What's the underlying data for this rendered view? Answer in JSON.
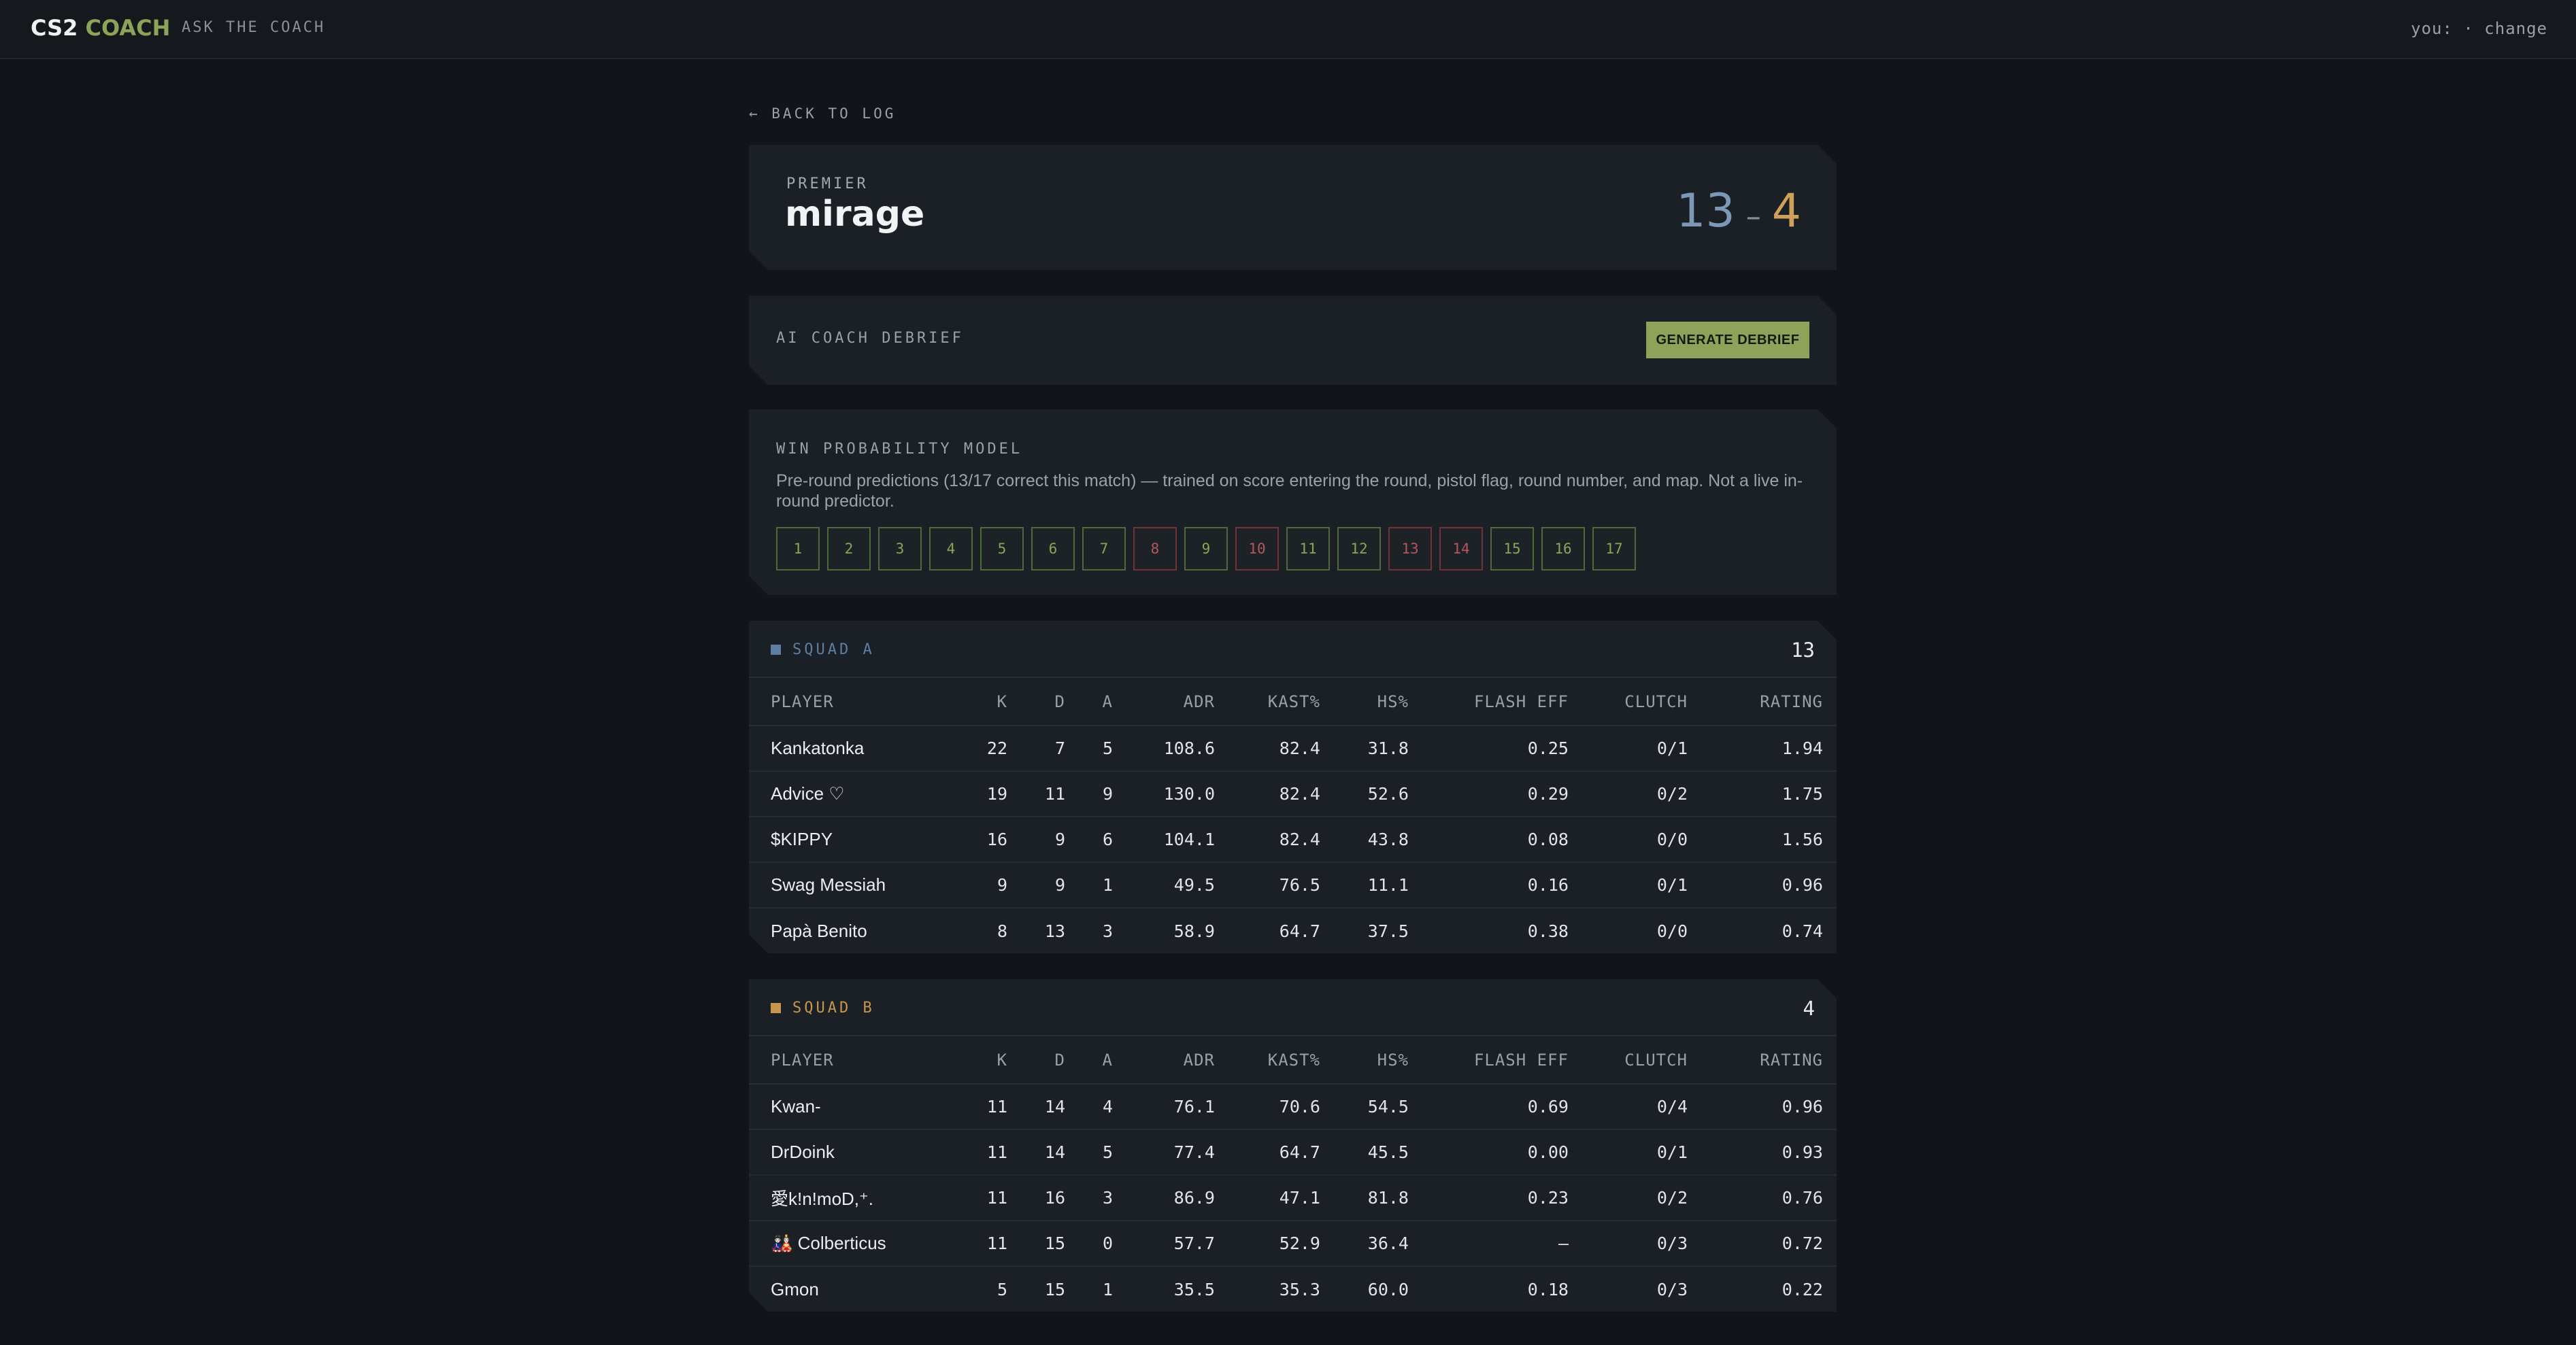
{
  "header": {
    "brand_part1": "CS2",
    "brand_part2": "COACH",
    "nav_link": "ASK THE COACH",
    "user_text": "you: · change"
  },
  "back_link": "← BACK TO LOG",
  "match": {
    "mode": "PREMIER",
    "map": "mirage",
    "score_a": "13",
    "score_sep": "–",
    "score_b": "4"
  },
  "debrief": {
    "label": "AI COACH DEBRIEF",
    "button_label": "GENERATE DEBRIEF"
  },
  "win_model": {
    "label": "WIN PROBABILITY MODEL",
    "description": "Pre-round predictions (13/17 correct this match) — trained on score entering the round, pistol flag, round number, and map. Not a live in-round predictor.",
    "rounds": [
      {
        "n": "1",
        "correct": true
      },
      {
        "n": "2",
        "correct": true
      },
      {
        "n": "3",
        "correct": true
      },
      {
        "n": "4",
        "correct": true
      },
      {
        "n": "5",
        "correct": true
      },
      {
        "n": "6",
        "correct": true
      },
      {
        "n": "7",
        "correct": true
      },
      {
        "n": "8",
        "correct": false
      },
      {
        "n": "9",
        "correct": true
      },
      {
        "n": "10",
        "correct": false
      },
      {
        "n": "11",
        "correct": true
      },
      {
        "n": "12",
        "correct": true
      },
      {
        "n": "13",
        "correct": false
      },
      {
        "n": "14",
        "correct": false
      },
      {
        "n": "15",
        "correct": true
      },
      {
        "n": "16",
        "correct": true
      },
      {
        "n": "17",
        "correct": true
      }
    ]
  },
  "columns": [
    "PLAYER",
    "K",
    "D",
    "A",
    "ADR",
    "KAST%",
    "HS%",
    "FLASH EFF",
    "CLUTCH",
    "RATING"
  ],
  "squads": [
    {
      "name": "SQUAD A",
      "color": "#5e7ea3",
      "score": "13",
      "players": [
        [
          "Kankatonka",
          "22",
          "7",
          "5",
          "108.6",
          "82.4",
          "31.8",
          "0.25",
          "0/1",
          "1.94"
        ],
        [
          "Advice ♡",
          "19",
          "11",
          "9",
          "130.0",
          "82.4",
          "52.6",
          "0.29",
          "0/2",
          "1.75"
        ],
        [
          "$KIPPY",
          "16",
          "9",
          "6",
          "104.1",
          "82.4",
          "43.8",
          "0.08",
          "0/0",
          "1.56"
        ],
        [
          "Swag Messiah",
          "9",
          "9",
          "1",
          "49.5",
          "76.5",
          "11.1",
          "0.16",
          "0/1",
          "0.96"
        ],
        [
          "Papà Benito",
          "8",
          "13",
          "3",
          "58.9",
          "64.7",
          "37.5",
          "0.38",
          "0/0",
          "0.74"
        ]
      ]
    },
    {
      "name": "SQUAD B",
      "color": "#c9974c",
      "score": "4",
      "players": [
        [
          "Kwan-",
          "11",
          "14",
          "4",
          "76.1",
          "70.6",
          "54.5",
          "0.69",
          "0/4",
          "0.96"
        ],
        [
          "DrDoink",
          "11",
          "14",
          "5",
          "77.4",
          "64.7",
          "45.5",
          "0.00",
          "0/1",
          "0.93"
        ],
        [
          "愛k!n!moD,⁺.",
          "11",
          "16",
          "3",
          "86.9",
          "47.1",
          "81.8",
          "0.23",
          "0/2",
          "0.76"
        ],
        [
          "🎎 Colberticus",
          "11",
          "15",
          "0",
          "57.7",
          "52.9",
          "36.4",
          "—",
          "0/3",
          "0.72"
        ],
        [
          "Gmon",
          "5",
          "15",
          "1",
          "35.5",
          "35.3",
          "60.0",
          "0.18",
          "0/3",
          "0.22"
        ]
      ]
    }
  ]
}
